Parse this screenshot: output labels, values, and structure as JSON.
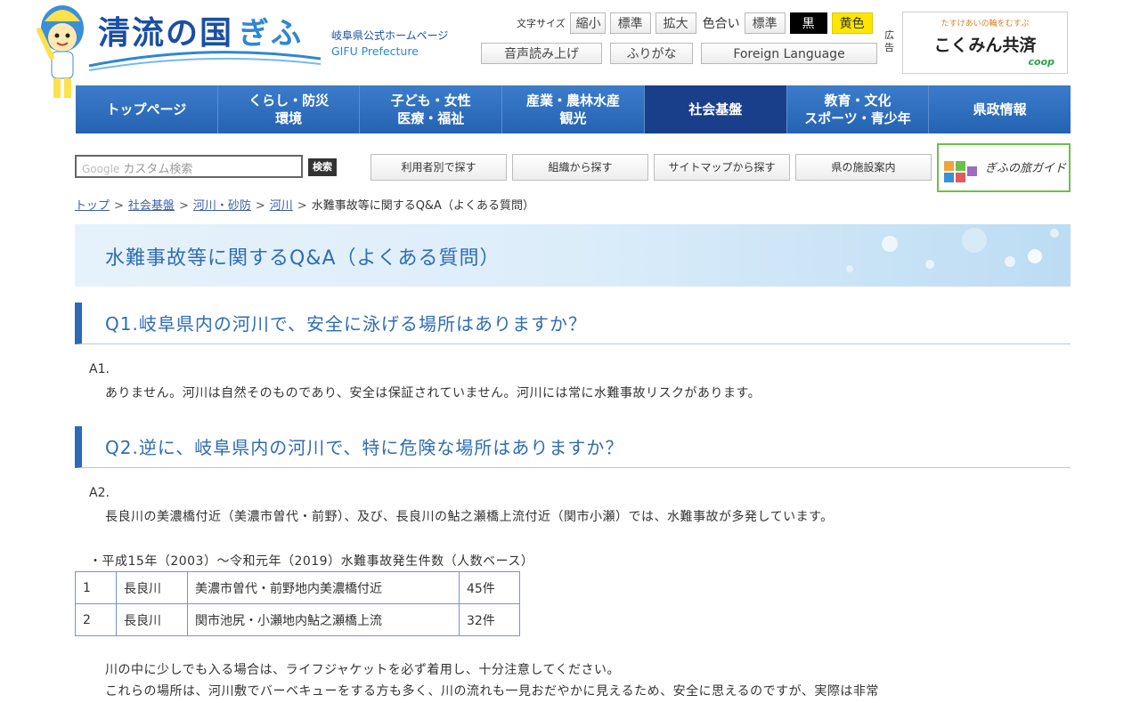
{
  "header": {
    "logo_title": "清流の国",
    "logo_title_gifu": "ぎふ",
    "logo_sub_jp": "岐阜県公式ホームページ",
    "logo_sub_en": "GIFU Prefecture",
    "font_size_label": "文字サイズ",
    "font_size_buttons": [
      "縮小",
      "標準",
      "拡大"
    ],
    "color_label": "色合い",
    "color_buttons": [
      "標準",
      "黒",
      "黄色"
    ],
    "read_aloud": "音声読み上げ",
    "furigana": "ふりがな",
    "foreign_language": "Foreign Language",
    "ad_label": "広告",
    "ad_tagline": "たすけあいの輪をむすぶ",
    "ad_name": "こくみん共済",
    "ad_coop": "coop"
  },
  "global_nav": [
    {
      "label": "トップページ"
    },
    {
      "label": "くらし・防災\n環境"
    },
    {
      "label": "子ども・女性\n医療・福祉"
    },
    {
      "label": "産業・農林水産\n観光"
    },
    {
      "label": "社会基盤",
      "active": true
    },
    {
      "label": "教育・文化\nスポーツ・青少年"
    },
    {
      "label": "県政情報"
    }
  ],
  "search": {
    "placeholder_prefix": "Google",
    "placeholder": "カスタム検索",
    "button": "検索"
  },
  "subnav": [
    "利用者別で探す",
    "組織から探す",
    "サイトマップから探す",
    "県の施設案内"
  ],
  "guide": {
    "label": "ぎふの旅ガイド"
  },
  "breadcrumb": {
    "links": [
      "トップ",
      "社会基盤",
      "河川・砂防",
      "河川"
    ],
    "separator": ">",
    "current": "水難事故等に関するQ&A（よくある質問）"
  },
  "page_title": "水難事故等に関するQ&A（よくある質問）",
  "qa": [
    {
      "question": "Q1.岐阜県内の河川で、安全に泳げる場所はありますか？",
      "answer_label": "A1.",
      "answer": "ありません。河川は自然そのものであり、安全は保証されていません。河川には常に水難事故リスクがあります。"
    },
    {
      "question": "Q2.逆に、岐阜県内の河川で、特に危険な場所はありますか？",
      "answer_label": "A2.",
      "answer": "長良川の美濃橋付近（美濃市曽代・前野）、及び、長良川の鮎之瀬橋上流付近（関市小瀬）では、水難事故が多発しています。"
    }
  ],
  "stats_caption": "・平成15年（2003）～令和元年（2019）水難事故発生件数（人数ベース）",
  "table_rows": [
    {
      "no": "1",
      "river": "長良川",
      "location": "美濃市曽代・前野地内美濃橋付近",
      "count": "45件"
    },
    {
      "no": "2",
      "river": "長良川",
      "location": "関市池尻・小瀬地内鮎之瀬橋上流",
      "count": "32件"
    }
  ],
  "notes": [
    "川の中に少しでも入る場合は、ライフジャケットを必ず着用し、十分注意してください。",
    "これらの場所は、河川敷でバーベキューをする方も多く、川の流れも一見おだやかに見えるため、安全に思えるのですが、実際は非常"
  ],
  "colors": {
    "nav_blue": "#2a6ab8",
    "nav_active": "#1a3f8a",
    "heading_blue": "#2e6db4",
    "highlight_yellow": "#ffe600"
  }
}
